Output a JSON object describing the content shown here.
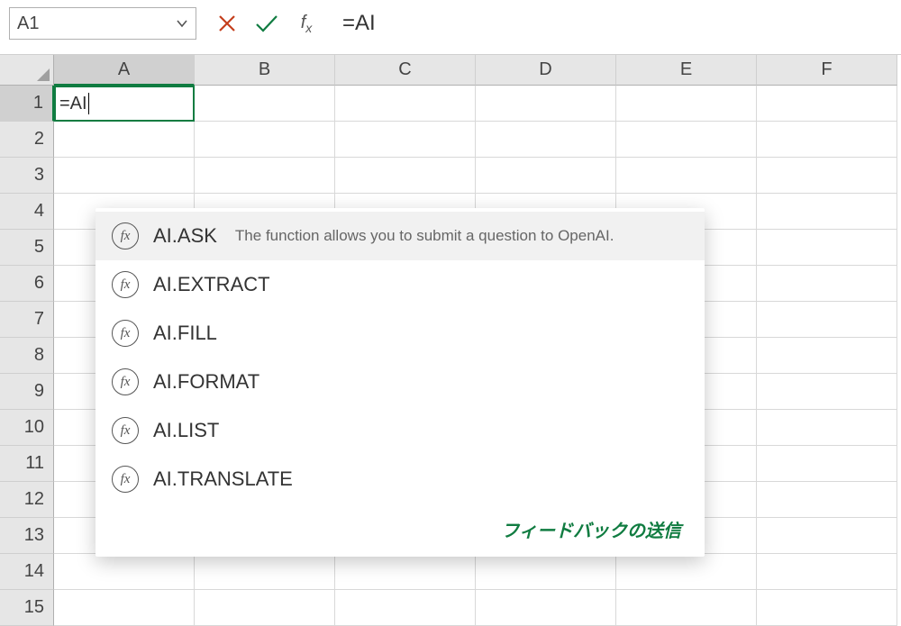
{
  "nameBox": {
    "value": "A1"
  },
  "formulaBar": {
    "input": "=AI"
  },
  "activeCell": {
    "display": "=AI"
  },
  "columns": [
    "A",
    "B",
    "C",
    "D",
    "E",
    "F"
  ],
  "rows": [
    "1",
    "2",
    "3",
    "4",
    "5",
    "6",
    "7",
    "8",
    "9",
    "10",
    "11",
    "12",
    "13",
    "14",
    "15"
  ],
  "autocomplete": {
    "items": [
      {
        "name": "AI.ASK",
        "desc": "The function allows you to submit a question to OpenAI."
      },
      {
        "name": "AI.EXTRACT",
        "desc": ""
      },
      {
        "name": "AI.FILL",
        "desc": ""
      },
      {
        "name": "AI.FORMAT",
        "desc": ""
      },
      {
        "name": "AI.LIST",
        "desc": ""
      },
      {
        "name": "AI.TRANSLATE",
        "desc": ""
      }
    ],
    "feedback_label": "フィードバックの送信"
  },
  "colors": {
    "accent": "#107c41"
  }
}
